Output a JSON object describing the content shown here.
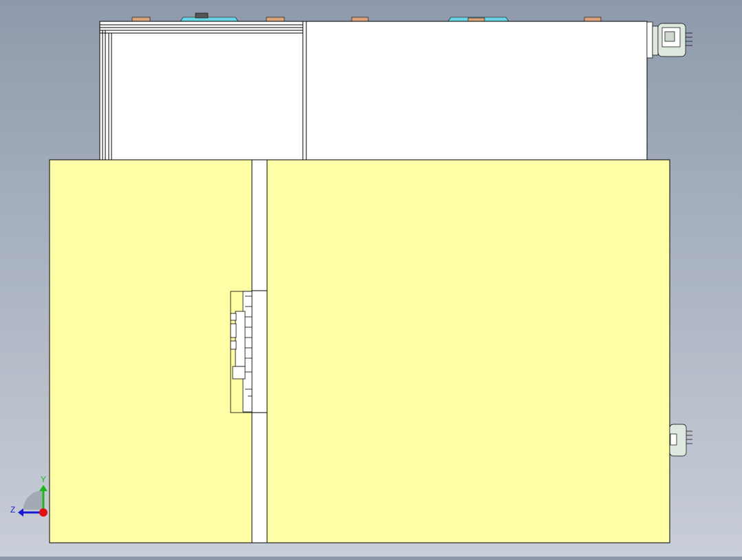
{
  "viewport": {
    "background_top": "#8e9aab",
    "background_bottom": "#c9ced8",
    "model": {
      "panel_fill": "#ffffa8",
      "frame_fill": "#ffffff",
      "outline": "#000000",
      "connector_fill": "#dfe8df",
      "clip_fill": "#d9a27a",
      "clamp_fill": "#67d3e0"
    }
  },
  "triad": {
    "y_label": "Y",
    "z_label": "Z",
    "y_color": "#1fb51f",
    "z_color": "#1a1ad6",
    "origin_color": "#e01010"
  }
}
